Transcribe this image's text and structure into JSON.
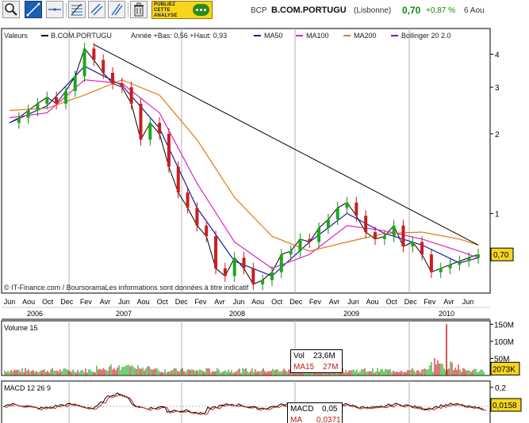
{
  "toolbar": {
    "buttons": [
      {
        "icon": "zoom-icon",
        "label": "Zoom"
      },
      {
        "icon": "trendline-icon",
        "label": "Trend line"
      },
      {
        "icon": "horizontal-line-icon",
        "label": "Horizontal line"
      },
      {
        "icon": "fibonacci-icon",
        "label": "Fibonacci"
      },
      {
        "icon": "channel-icon",
        "label": "Channel"
      },
      {
        "icon": "parallel-lines-icon",
        "label": "Parallel lines"
      },
      {
        "icon": "trash-icon",
        "label": "Delete"
      }
    ],
    "publish_lines": [
      "PUBLIEZ",
      "CETTE",
      "ANALYSE"
    ]
  },
  "header": {
    "ticker": "BCP",
    "name": "B.COM.PORTUGU",
    "market": "(Lisbonne)",
    "price": "0,70",
    "change": "+0,87 %",
    "date": "6 Aou",
    "price_color": "#0a8a0a"
  },
  "legend": {
    "values_label": "Valeurs",
    "instrument": "B.COM.PORTUGU",
    "range_text": "Année +Bas: 0,56 +Haut: 0,93",
    "items": [
      {
        "label": "MA50",
        "color": "#1a1aa8"
      },
      {
        "label": "MA100",
        "color": "#e020c8"
      },
      {
        "label": "MA200",
        "color": "#e07a10"
      },
      {
        "label": "Bollinger 20 2.0",
        "color": "#7a18b8"
      }
    ]
  },
  "footer_note": "© IT-Finance.com / BoursoramaLes informations sont données à titre indicatif",
  "chart_data": [
    {
      "type": "line",
      "title": "B.COM.PORTUGU",
      "scale": "log",
      "y_ticks": [
        "4",
        "3",
        "2",
        "1"
      ],
      "y_tick_values": [
        4,
        3,
        2,
        1
      ],
      "last_value_label": "0,70",
      "x_month_labels": [
        "Jun",
        "Aou",
        "Oct",
        "Dec",
        "Fev",
        "Avr",
        "Jun",
        "Aou",
        "Oct",
        "Dec",
        "Fev",
        "Avr",
        "Jun",
        "Aou",
        "Oct",
        "Dec",
        "Fev",
        "Avr",
        "Jun",
        "Aou",
        "Oct",
        "Dec",
        "Fev",
        "Avr",
        "Jun"
      ],
      "x_year_labels": [
        "2006",
        "2007",
        "2008",
        "2009",
        "2010"
      ],
      "series": [
        {
          "name": "B.COM.PORTUGU",
          "color": "#000000",
          "x": [
            0,
            1,
            2,
            3,
            4,
            5,
            6,
            7,
            8,
            9,
            10,
            11,
            12,
            13,
            14,
            15,
            16,
            17,
            18,
            19,
            20,
            21,
            22,
            23,
            24,
            25,
            26,
            27,
            28,
            29,
            30,
            31,
            32,
            33,
            34,
            35,
            36,
            37,
            38,
            39,
            40,
            41,
            42,
            43,
            44,
            45,
            46,
            47,
            48,
            49,
            50
          ],
          "y": [
            2.2,
            2.3,
            2.45,
            2.6,
            2.75,
            2.6,
            2.9,
            3.3,
            4.2,
            3.8,
            3.4,
            3.1,
            3.0,
            2.6,
            1.9,
            2.2,
            2.0,
            1.5,
            1.2,
            1.05,
            0.9,
            0.82,
            0.62,
            0.58,
            0.68,
            0.62,
            0.54,
            0.56,
            0.6,
            0.7,
            0.72,
            0.8,
            0.78,
            0.88,
            0.95,
            1.05,
            1.1,
            0.98,
            0.85,
            0.8,
            0.82,
            0.9,
            0.75,
            0.78,
            0.7,
            0.6,
            0.62,
            0.64,
            0.66,
            0.68,
            0.7
          ]
        },
        {
          "name": "MA50",
          "color": "#1a1aa8",
          "x": [
            0,
            4,
            8,
            12,
            16,
            20,
            24,
            28,
            32,
            36,
            40,
            44,
            48,
            50
          ],
          "y": [
            2.2,
            2.55,
            3.6,
            3.05,
            2.1,
            1.05,
            0.66,
            0.58,
            0.78,
            1.0,
            0.84,
            0.76,
            0.65,
            0.68
          ]
        },
        {
          "name": "MA100",
          "color": "#e020c8",
          "x": [
            0,
            4,
            8,
            12,
            16,
            20,
            24,
            28,
            32,
            36,
            40,
            44,
            48,
            50
          ],
          "y": [
            2.3,
            2.4,
            3.2,
            3.1,
            2.4,
            1.3,
            0.78,
            0.62,
            0.7,
            0.9,
            0.86,
            0.8,
            0.72,
            0.68
          ]
        },
        {
          "name": "MA200",
          "color": "#e07a10",
          "x": [
            0,
            4,
            8,
            12,
            16,
            20,
            24,
            28,
            32,
            36,
            40,
            44,
            48,
            50
          ],
          "y": [
            2.45,
            2.5,
            2.8,
            3.2,
            2.8,
            1.9,
            1.15,
            0.82,
            0.72,
            0.78,
            0.84,
            0.85,
            0.8,
            0.76
          ]
        },
        {
          "name": "Trend",
          "color": "#000000",
          "x": [
            9,
            50
          ],
          "y": [
            4.35,
            0.76
          ]
        }
      ]
    },
    {
      "type": "bar",
      "title": "Volume 15",
      "y_ticks": [
        "150M",
        "100M",
        "50M"
      ],
      "y_tick_values": [
        150,
        100,
        50
      ],
      "readout": {
        "vol_label": "Vol",
        "vol_value": "23,6M",
        "ma_label": "MA15",
        "ma_value": "27M"
      },
      "last_value_label": "2073K"
    },
    {
      "type": "line",
      "title": "MACD 12 26 9",
      "y_ticks": [
        "0,2"
      ],
      "y_tick_values": [
        0.2
      ],
      "readout": {
        "macd_label": "MACD",
        "macd_value": "0,05",
        "ma_label": "MA",
        "ma_value": "0,0371"
      },
      "last_value_label": "0,0158"
    }
  ]
}
